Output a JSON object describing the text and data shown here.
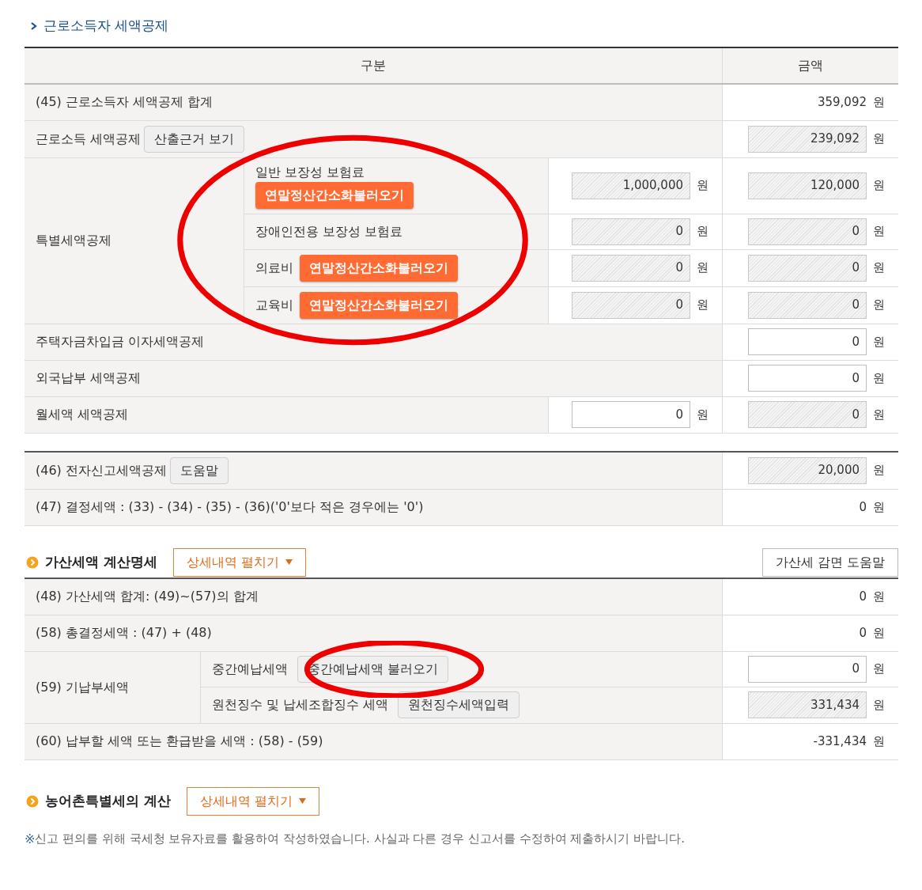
{
  "section_title": "근로소득자 세액공제",
  "table1": {
    "columns": [
      "구분",
      "금액"
    ],
    "rows": [
      {
        "kind": "simple",
        "label": "(45) 근로소득자 세액공제 합계",
        "amount": {
          "kind": "text",
          "value": "359,092",
          "unit": "원"
        }
      },
      {
        "kind": "simple",
        "label": "근로소득 세액공제",
        "button": "산출근거 보기",
        "amount": {
          "kind": "readonly",
          "value": "239,092",
          "unit": "원"
        }
      },
      {
        "kind": "group",
        "label": "특별세액공제",
        "circled": true,
        "items": [
          {
            "kind": "stacked",
            "label": "일반 보장성 보험료",
            "button": "연말정산간소화불러오기",
            "middle": {
              "kind": "readonly",
              "value": "1,000,000",
              "unit": "원"
            },
            "amount": {
              "kind": "readonly",
              "value": "120,000",
              "unit": "원"
            }
          },
          {
            "kind": "plain",
            "label": "장애인전용 보장성 보험료",
            "middle": {
              "kind": "readonly",
              "value": "0",
              "unit": "원"
            },
            "amount": {
              "kind": "readonly",
              "value": "0",
              "unit": "원"
            }
          },
          {
            "kind": "inline",
            "label": "의료비",
            "button": "연말정산간소화불러오기",
            "middle": {
              "kind": "readonly",
              "value": "0",
              "unit": "원"
            },
            "amount": {
              "kind": "readonly",
              "value": "0",
              "unit": "원"
            }
          },
          {
            "kind": "inline",
            "label": "교육비",
            "button": "연말정산간소화불러오기",
            "middle": {
              "kind": "readonly",
              "value": "0",
              "unit": "원"
            },
            "amount": {
              "kind": "readonly",
              "value": "0",
              "unit": "원"
            }
          }
        ]
      },
      {
        "kind": "simple",
        "label": "주택자금차입금 이자세액공제",
        "amount": {
          "kind": "input",
          "value": "0",
          "unit": "원"
        }
      },
      {
        "kind": "simple",
        "label": "외국납부 세액공제",
        "amount": {
          "kind": "input",
          "value": "0",
          "unit": "원"
        }
      },
      {
        "kind": "simple",
        "label": "월세액 세액공제",
        "middle": {
          "kind": "input",
          "value": "0",
          "unit": "원"
        },
        "amount": {
          "kind": "readonly",
          "value": "0",
          "unit": "원"
        }
      }
    ]
  },
  "table2": {
    "rows": [
      {
        "kind": "simple",
        "label": "(46) 전자신고세액공제",
        "button": "도움말",
        "amount": {
          "kind": "readonly",
          "value": "20,000",
          "unit": "원"
        }
      },
      {
        "kind": "simple",
        "label": "(47) 결정세액 : (33) - (34) - (35) - (36)('0'보다 적은 경우에는 '0')",
        "amount": {
          "kind": "text",
          "value": "0",
          "unit": "원"
        }
      }
    ]
  },
  "penalty_section": {
    "title": "가산세액 계산명세",
    "toggle": "상세내역 펼치기",
    "help_button": "가산세 감면 도움말",
    "rows": [
      {
        "kind": "simple",
        "label": "(48) 가산세액 합계: (49)~(57)의 합계",
        "amount": {
          "kind": "text",
          "value": "0",
          "unit": "원"
        }
      },
      {
        "kind": "simple",
        "label": "(58) 총결정세액 : (47) + (48)",
        "amount": {
          "kind": "text",
          "value": "0",
          "unit": "원"
        }
      },
      {
        "kind": "group",
        "label": "(59) 기납부세액",
        "circled": true,
        "items": [
          {
            "kind": "inline",
            "label": "중간예납세액",
            "button": "중간예납세액 불러오기",
            "amount": {
              "kind": "input",
              "value": "0",
              "unit": "원"
            }
          },
          {
            "kind": "inline",
            "label": "원천징수 및 납세조합징수 세액",
            "button": "원천징수세액입력",
            "amount": {
              "kind": "readonly",
              "value": "331,434",
              "unit": "원"
            }
          }
        ]
      },
      {
        "kind": "simple",
        "label": "(60) 납부할 세액 또는 환급받을 세액 : (58) - (59)",
        "amount": {
          "kind": "text",
          "value": "-331,434",
          "unit": "원"
        }
      }
    ]
  },
  "rural_section": {
    "title": "농어촌특별세의 계산",
    "toggle": "상세내역 펼치기"
  },
  "note": {
    "mark": "※",
    "text": "신고 편의를 위해 국세청 보유자료를 활용하여 작성하였습니다. 사실과 다른 경우 신고서를 수정하여 제출하시기 바랍니다."
  }
}
